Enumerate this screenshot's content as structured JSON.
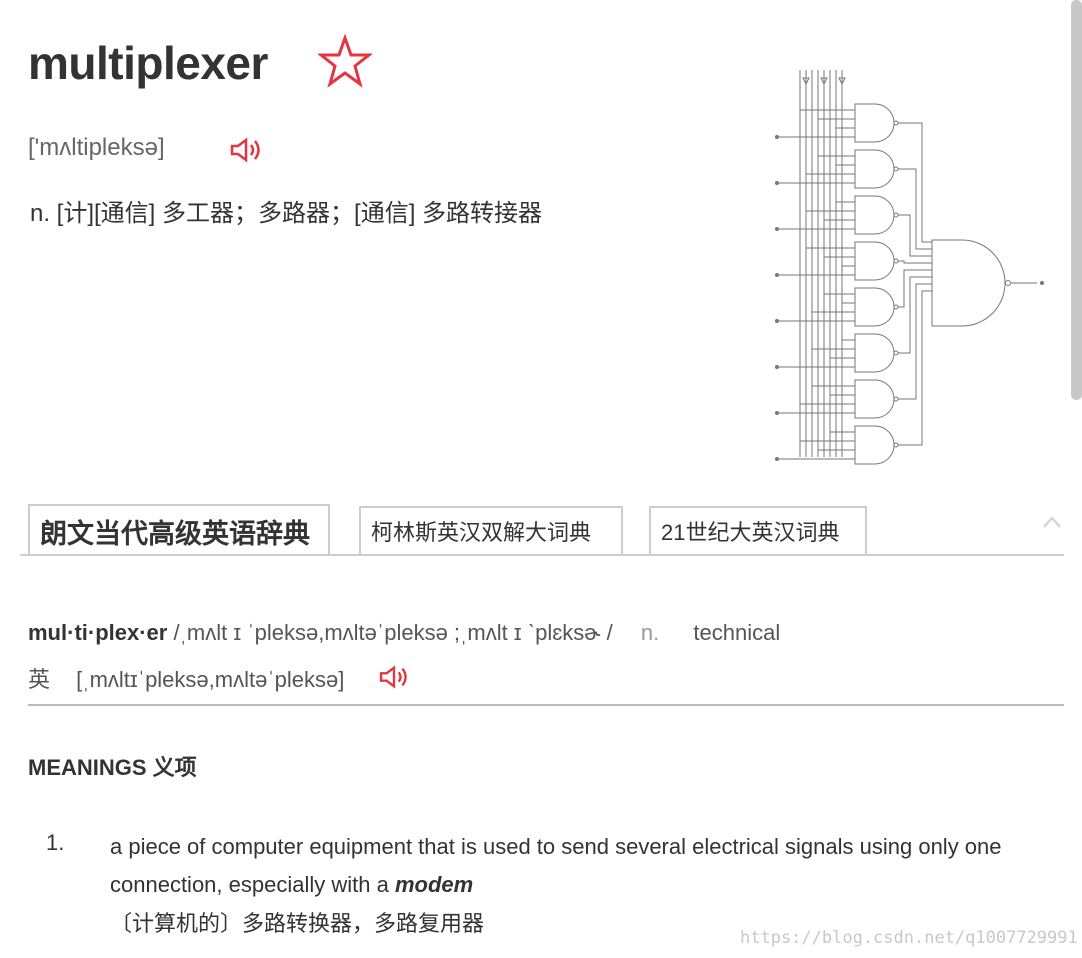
{
  "word": {
    "headword": "multiplexer",
    "phonetic": "['mʌltipleksə]",
    "definition": "n. [计][通信] 多工器；多路器；[通信] 多路转接器",
    "icons": {
      "favorite": "star-outline-icon",
      "pronounce": "speaker-icon"
    },
    "accent_color": "#e3343f"
  },
  "dictionary_tabs": [
    {
      "label": "朗文当代高级英语辞典",
      "active": true
    },
    {
      "label": "柯林斯英汉双解大词典",
      "active": false
    },
    {
      "label": "21世纪大英汉词典",
      "active": false
    }
  ],
  "entry": {
    "syllables": "mul·ti·plex·er",
    "pronunciation": "/ˌmʌlt ɪ ˈpleksə,mʌltəˈpleksə ;ˌmʌlt ɪ ˋplɛksɚ /",
    "pos": "n.",
    "register": "technical",
    "uk_label": "英",
    "uk_phonetic": "[ˌmʌltɪˈpleksə,mʌltəˈpleksə]"
  },
  "meanings": {
    "heading": "MEANINGS 义项",
    "items": [
      {
        "number": "1.",
        "text_before": "a piece of computer equipment that is used to send several electrical signals using only one connection, especially with a ",
        "emphasis": "modem",
        "translation": "〔计算机的〕多路转换器，多路复用器"
      }
    ]
  },
  "watermark": "https://blog.csdn.net/q1007729991"
}
